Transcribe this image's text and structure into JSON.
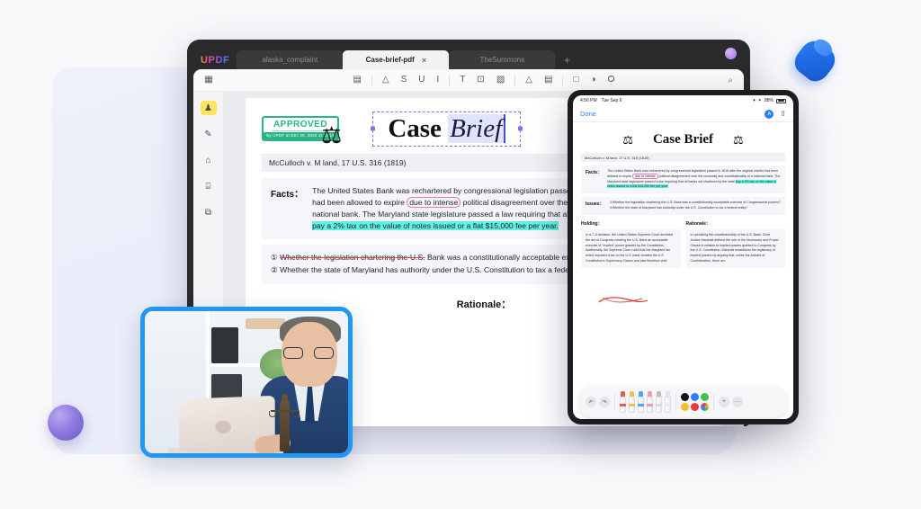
{
  "app": {
    "logo": "UPDF",
    "tabs": [
      {
        "label": "alaska_complaint",
        "active": false
      },
      {
        "label": "Case-brief-pdf",
        "active": true
      },
      {
        "label": "TheSummons",
        "active": false
      }
    ],
    "add_tab": "+",
    "close_tab": "×"
  },
  "toolbar": {
    "items": [
      {
        "name": "comment-icon",
        "glyph": "▤"
      },
      {
        "name": "highlight-icon",
        "glyph": "△"
      },
      {
        "name": "strikethrough-icon",
        "glyph": "S"
      },
      {
        "name": "underline-icon",
        "glyph": "U"
      },
      {
        "name": "squiggly-icon",
        "glyph": "I"
      },
      {
        "name": "text-icon",
        "glyph": "T"
      },
      {
        "name": "text-box-icon",
        "glyph": "⊡"
      },
      {
        "name": "sticky-note-icon",
        "glyph": "▧"
      },
      {
        "name": "pencil-icon",
        "glyph": "△"
      },
      {
        "name": "eraser-icon",
        "glyph": "▤"
      },
      {
        "name": "shapes-icon",
        "glyph": "□"
      },
      {
        "name": "stamp-icon",
        "glyph": "◑"
      },
      {
        "name": "signature-icon",
        "glyph": "⭘"
      }
    ],
    "search": "⌕"
  },
  "sidebar": {
    "items": [
      {
        "name": "sidebar-item-annotate",
        "glyph": "♟",
        "active": true
      },
      {
        "name": "sidebar-item-edit",
        "glyph": "✎",
        "active": false
      },
      {
        "name": "sidebar-item-organize",
        "glyph": "⌂",
        "active": false
      },
      {
        "name": "sidebar-item-forms",
        "glyph": "⌸",
        "active": false
      },
      {
        "name": "sidebar-item-pages",
        "glyph": "⧉",
        "active": false
      }
    ]
  },
  "document": {
    "stamp": {
      "text": "APPROVED",
      "subtext": "By UPDF at Dec 29, 2022 at 14:16"
    },
    "title_main": "Case ",
    "title_italic": "Brief",
    "citation": "McCulloch v. M land, 17 U.S. 316 (1819)",
    "facts_label": "Facts：",
    "facts_text_1": "The United States Bank was rechartered by congressional legislation passed in 1816 after the original charter had been allowed to expire ",
    "facts_highlight_pink": "due to intense",
    "facts_text_2": " political disagreement over the necessity and constitutionality of a national bank. The Maryland state legislature passed a law requiring that all banks not chartered by the state ",
    "facts_highlight_cyan": "pay a 2% tax on the value of notes issued or a flat $15,000 fee per year.",
    "issue_1_struck": "Whether the legislation chartering the U.S.",
    "issue_1_rest": " Bank was a constitutionally acceptable exercise of Congressional powers?",
    "issue_1_marker": "①",
    "issue_2_marker": "②",
    "issue_2": "Whether the state of Maryland has authority under the U.S. Constitution to tax a federal entity?",
    "rationale_label": "Rationale：",
    "issues_label": "Issues：",
    "holding_label": "Holding：",
    "holding_text": "In a 7–0 decision, the United States Supreme Court declared the act of Congress creating the U.S. Bank an acceptable exercise of \"implied\" power granted by the Constitution. Additionally, the Supreme Court ruled that the Maryland tax which imposed a tax on the U.S. bank violated the U.S. Constitution's Supremacy Clause and was therefore void.",
    "rationale_text": "In upholding the constitutionality of the U.S. Bank, Chief Justice Marshall defined the role of the Necessary and Proper Clause in relation to implied powers granted to Congress by the U.S. Constitution. Marshall establishes the legitimacy of implied powers by arguing that, unlike the Articles of Confederation, there are"
  },
  "ipad": {
    "status": {
      "time": "4:56 PM",
      "date": "Tue Sep 6",
      "wifi": "▾",
      "bluetooth": "✶",
      "battery": "88%"
    },
    "nav": {
      "done": "Done",
      "badge": "A",
      "share": "⇧"
    },
    "title": "Case Brief",
    "scales_icon": "⚖",
    "markup": {
      "undo": "↶",
      "redo": "↷",
      "tools": [
        {
          "name": "marker-tool",
          "color": "#e25b5b"
        },
        {
          "name": "highlighter-tool",
          "color": "#f0c24a"
        },
        {
          "name": "pen-tool",
          "color": "#4aa7ef"
        },
        {
          "name": "eraser-tool",
          "color": "#f09bb0"
        },
        {
          "name": "pencil-tool",
          "color": "#bdbdc4"
        },
        {
          "name": "ruler-tool",
          "color": "#e4e4ea"
        }
      ],
      "colors": [
        "#141418",
        "#2d7ff9",
        "#3ec14f",
        "#f2c029",
        "#e83b3b",
        "#8a5ce8"
      ],
      "add": "+",
      "more": "···"
    }
  }
}
